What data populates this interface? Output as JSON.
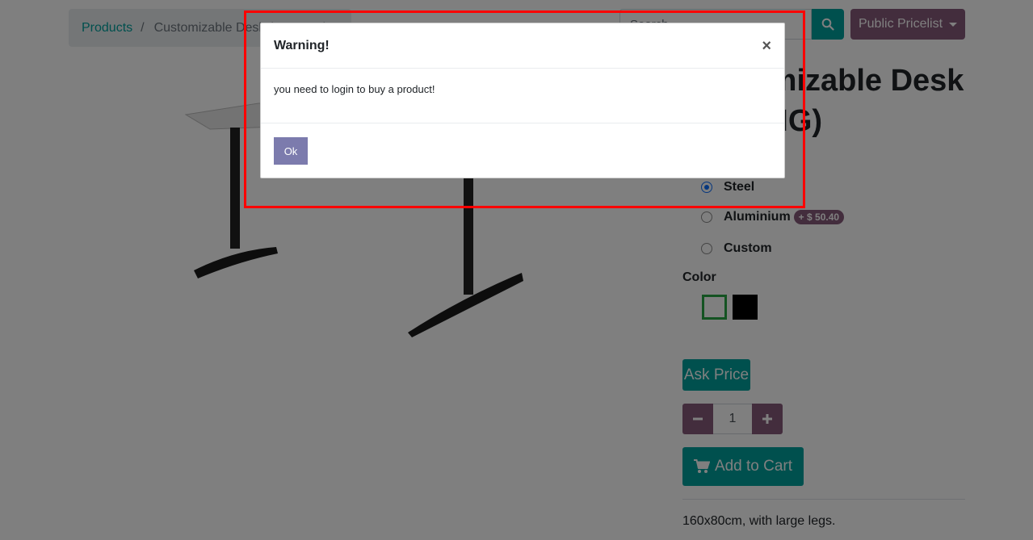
{
  "breadcrumb": {
    "link": "Products",
    "separator": "/",
    "current": "Customizable Desk (CONFIG)"
  },
  "search": {
    "placeholder": "Search..."
  },
  "pricelist": {
    "label": "Public Pricelist"
  },
  "product": {
    "title": "Customizable Desk (CONFIG)",
    "options": [
      {
        "label": "Steel",
        "checked": true
      },
      {
        "label": "Aluminium",
        "extra": "+ $ 50.40",
        "checked": false
      },
      {
        "label": "Custom",
        "checked": false
      }
    ],
    "color_label": "Color",
    "colors": [
      "#ffffff",
      "#000000"
    ],
    "ask_price_label": "Ask Price",
    "quantity": "1",
    "add_to_cart_label": "Add to Cart",
    "description": "160x80cm, with large legs."
  },
  "modal": {
    "title": "Warning!",
    "close_glyph": "×",
    "message": "you need to login to buy a product!",
    "ok_label": "Ok"
  },
  "colors": {
    "primary": "#00A09D",
    "secondary": "#875A7B",
    "modal_button": "#7C7BAD",
    "highlight": "#ff0000"
  }
}
